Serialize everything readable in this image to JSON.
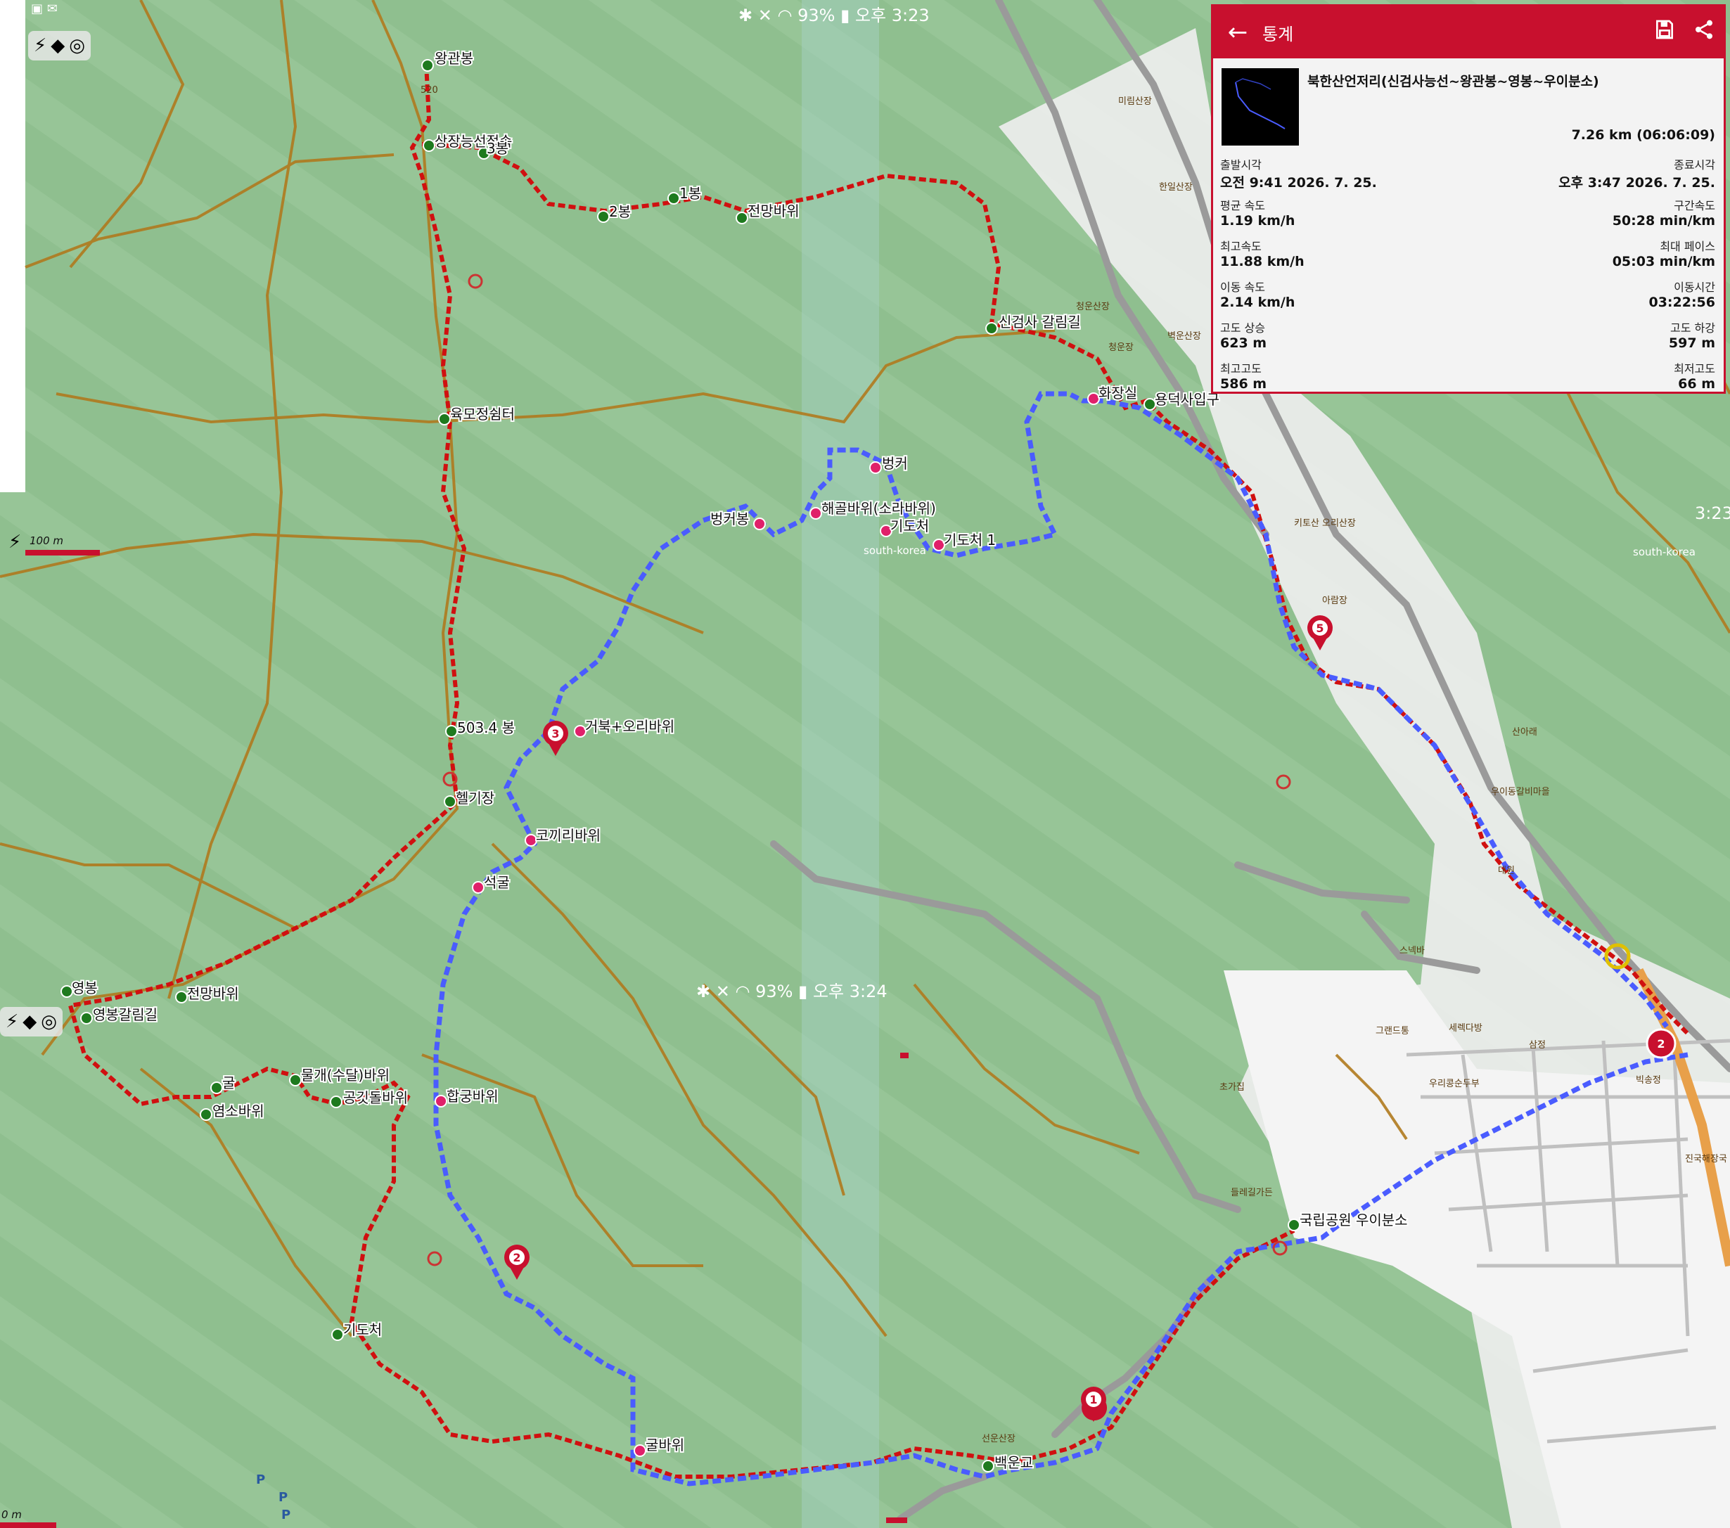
{
  "status_top": {
    "battery": "93%",
    "time": "오후 3:23"
  },
  "status_mid": {
    "battery": "93%",
    "time": "오후 3:24"
  },
  "status_side_time": "3:23",
  "scale_label": "100 m",
  "scale_label_2": "0 m",
  "panel": {
    "title": "통계",
    "track_name": "북한산언저리(신검사능선~왕관봉~영봉~우이분소)",
    "distance": "7.26 km (06:06:09)",
    "rows": [
      {
        "left_label": "출발시각",
        "left_value": "오전 9:41 2026. 7. 25.",
        "right_label": "종료시각",
        "right_value": "오후 3:47 2026. 7. 25."
      },
      {
        "left_label": "평균 속도",
        "left_value": "1.19 km/h",
        "right_label": "구간속도",
        "right_value": "50:28 min/km"
      },
      {
        "left_label": "최고속도",
        "left_value": "11.88 km/h",
        "right_label": "최대 페이스",
        "right_value": "05:03 min/km"
      },
      {
        "left_label": "이동 속도",
        "left_value": "2.14 km/h",
        "right_label": "이동시간",
        "right_value": "03:22:56"
      },
      {
        "left_label": "고도 상승",
        "left_value": "623 m",
        "right_label": "고도 하강",
        "right_value": "597 m"
      },
      {
        "left_label": "최고고도",
        "left_value": "586 m",
        "right_label": "최저고도",
        "right_value": "66 m"
      }
    ]
  },
  "map": {
    "colors": {
      "terrain": "#8fbf8f",
      "trail": "#b07a1e",
      "red_route": "#d01010",
      "blue_route": "#4a5cff",
      "town": "#f0f0f0"
    },
    "waypoints": [
      {
        "label": "왕관봉",
        "kind": "green"
      },
      {
        "label": "상장능선접속",
        "kind": "green"
      },
      {
        "label": "3봉",
        "kind": "green"
      },
      {
        "label": "2봉",
        "kind": "green"
      },
      {
        "label": "1봉",
        "kind": "green"
      },
      {
        "label": "전망바위",
        "kind": "green"
      },
      {
        "label": "신검사 갈림길",
        "kind": "green"
      },
      {
        "label": "육모정쉼터",
        "kind": "green"
      },
      {
        "label": "503.4 봉",
        "kind": "green"
      },
      {
        "label": "헬기장",
        "kind": "green"
      },
      {
        "label": "영봉",
        "kind": "green"
      },
      {
        "label": "영봉갈림길",
        "kind": "green"
      },
      {
        "label": "전망바위",
        "kind": "green"
      },
      {
        "label": "굴",
        "kind": "green"
      },
      {
        "label": "염소바위",
        "kind": "green"
      },
      {
        "label": "물개(수달)바위",
        "kind": "green"
      },
      {
        "label": "공깃돌바위",
        "kind": "green"
      },
      {
        "label": "기도처",
        "kind": "green"
      },
      {
        "label": "백운교",
        "kind": "green"
      },
      {
        "label": "국립공원 우이분소",
        "kind": "green"
      },
      {
        "label": "용덕사입구",
        "kind": "green"
      },
      {
        "label": "화장실",
        "kind": "pink"
      },
      {
        "label": "벙커",
        "kind": "pink"
      },
      {
        "label": "벙커봉",
        "kind": "pink"
      },
      {
        "label": "해골바위(소라바위)",
        "kind": "pink"
      },
      {
        "label": "기도처",
        "kind": "pink"
      },
      {
        "label": "기도처 1",
        "kind": "pink"
      },
      {
        "label": "거북+오리바위",
        "kind": "pink"
      },
      {
        "label": "코끼리바위",
        "kind": "pink"
      },
      {
        "label": "석굴",
        "kind": "pink"
      },
      {
        "label": "합궁바위",
        "kind": "pink"
      },
      {
        "label": "굴바위",
        "kind": "pink"
      }
    ],
    "markers": [
      {
        "label": "1",
        "color": "#c8102e"
      },
      {
        "label": "2",
        "color": "#c8102e"
      },
      {
        "label": "3",
        "color": "#c8102e"
      },
      {
        "label": "5",
        "color": "#c8102e"
      },
      {
        "label": "2",
        "color": "#c8102e"
      }
    ],
    "elevation_label": "520",
    "region_label": "south-korea",
    "region_label_2": "south-korea",
    "place_labels": [
      "미림산장",
      "한일산장",
      "청운산장",
      "청운장",
      "벽운산장",
      "키토산 오리산장",
      "아람장",
      "산아래",
      "우이동갈비마을",
      "대원",
      "스넥바",
      "그랜드통",
      "세렉다방",
      "삼정",
      "우리콩순두부",
      "빅송정",
      "초가집",
      "들레길가든",
      "선운산장",
      "진국해장국"
    ]
  }
}
